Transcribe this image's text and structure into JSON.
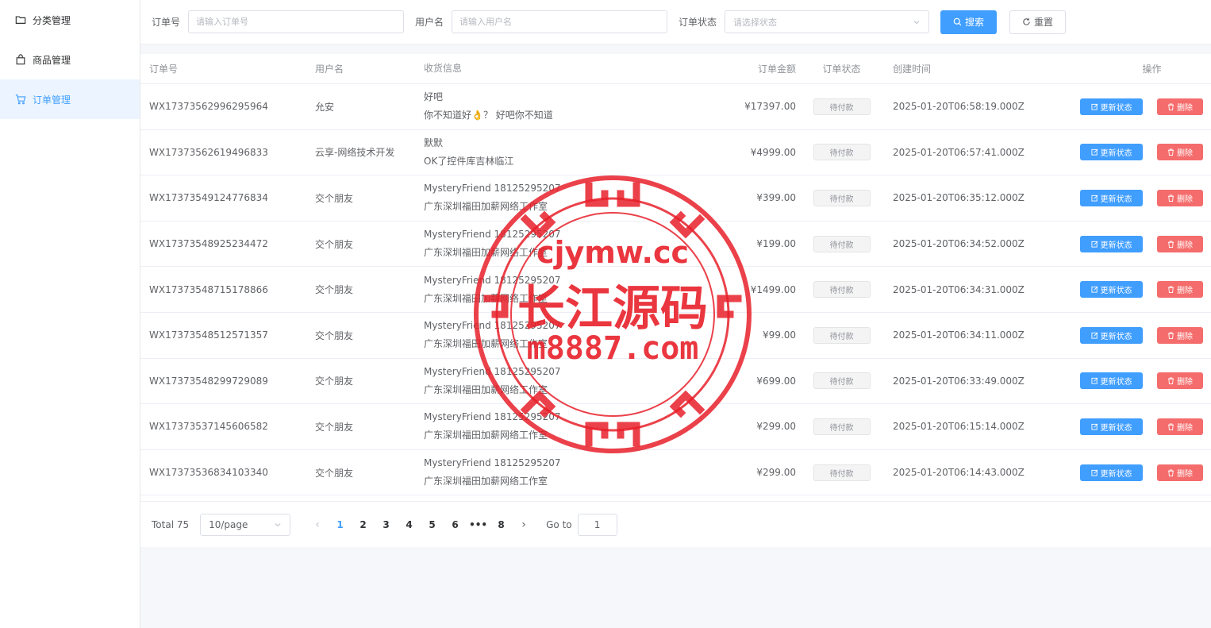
{
  "sidebar": {
    "items": [
      {
        "label": "分类管理",
        "icon": "folder-icon"
      },
      {
        "label": "商品管理",
        "icon": "bag-icon"
      },
      {
        "label": "订单管理",
        "icon": "cart-icon"
      }
    ]
  },
  "filters": {
    "order_no_label": "订单号",
    "order_no_placeholder": "请输入订单号",
    "username_label": "用户名",
    "username_placeholder": "请输入用户名",
    "status_label": "订单状态",
    "status_placeholder": "请选择状态",
    "search_label": "搜索",
    "reset_label": "重置"
  },
  "table": {
    "headers": {
      "order_no": "订单号",
      "username": "用户名",
      "shipping": "收货信息",
      "amount": "订单金额",
      "status": "订单状态",
      "created": "创建时间",
      "actions": "操作"
    },
    "update_label": "更新状态",
    "delete_label": "删除",
    "rows": [
      {
        "order_no": "WX17373562996295964",
        "username": "允安",
        "ship_line1": "好吧",
        "ship_line2": "你不知道好👌？ 好吧你不知道",
        "amount": "¥17397.00",
        "status": "待付款",
        "created": "2025-01-20T06:58:19.000Z"
      },
      {
        "order_no": "WX17373562619496833",
        "username": "云享-网络技术开发",
        "ship_line1": "默默",
        "ship_line2": "OK了控件库吉林临江",
        "amount": "¥4999.00",
        "status": "待付款",
        "created": "2025-01-20T06:57:41.000Z"
      },
      {
        "order_no": "WX17373549124776834",
        "username": "交个朋友",
        "ship_line1": "MysteryFriend 18125295207",
        "ship_line2": "广东深圳福田加薪网络工作室",
        "amount": "¥399.00",
        "status": "待付款",
        "created": "2025-01-20T06:35:12.000Z"
      },
      {
        "order_no": "WX17373548925234472",
        "username": "交个朋友",
        "ship_line1": "MysteryFriend 18125295207",
        "ship_line2": "广东深圳福田加薪网络工作室",
        "amount": "¥199.00",
        "status": "待付款",
        "created": "2025-01-20T06:34:52.000Z"
      },
      {
        "order_no": "WX17373548715178866",
        "username": "交个朋友",
        "ship_line1": "MysteryFriend 18125295207",
        "ship_line2": "广东深圳福田加薪网络工作室",
        "amount": "¥1499.00",
        "status": "待付款",
        "created": "2025-01-20T06:34:31.000Z"
      },
      {
        "order_no": "WX17373548512571357",
        "username": "交个朋友",
        "ship_line1": "MysteryFriend 18125295207",
        "ship_line2": "广东深圳福田加薪网络工作室",
        "amount": "¥99.00",
        "status": "待付款",
        "created": "2025-01-20T06:34:11.000Z"
      },
      {
        "order_no": "WX17373548299729089",
        "username": "交个朋友",
        "ship_line1": "MysteryFriend 18125295207",
        "ship_line2": "广东深圳福田加薪网络工作室",
        "amount": "¥699.00",
        "status": "待付款",
        "created": "2025-01-20T06:33:49.000Z"
      },
      {
        "order_no": "WX17373537145606582",
        "username": "交个朋友",
        "ship_line1": "MysteryFriend 18125295207",
        "ship_line2": "广东深圳福田加薪网络工作室",
        "amount": "¥299.00",
        "status": "待付款",
        "created": "2025-01-20T06:15:14.000Z"
      },
      {
        "order_no": "WX17373536834103340",
        "username": "交个朋友",
        "ship_line1": "MysteryFriend 18125295207",
        "ship_line2": "广东深圳福田加薪网络工作室",
        "amount": "¥299.00",
        "status": "待付款",
        "created": "2025-01-20T06:14:43.000Z"
      }
    ]
  },
  "pagination": {
    "total": "Total 75",
    "page_size": "10/page",
    "pages": [
      "1",
      "2",
      "3",
      "4",
      "5",
      "6",
      "•••",
      "8"
    ],
    "current": "1",
    "goto_label": "Go to",
    "goto_value": "1"
  },
  "watermark": {
    "line1": "cjymw.cc",
    "line2": "长江源码",
    "line3": "m8887.com"
  },
  "colors": {
    "primary": "#409eff",
    "danger": "#f56c6c",
    "stamp": "#e8202a"
  }
}
